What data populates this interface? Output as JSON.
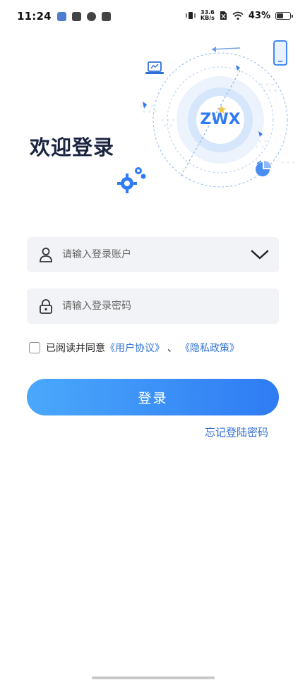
{
  "status_bar": {
    "time": "11:24",
    "net_speed_value": "33.6",
    "net_speed_unit": "KB/s",
    "battery_text": "43%",
    "battery_level": 0.43
  },
  "page": {
    "title": "欢迎登录",
    "brand_logo_text": "ZWX"
  },
  "form": {
    "username_placeholder": "请输入登录账户",
    "password_placeholder": "请输入登录密码",
    "agree_prefix": "已阅读并同意",
    "user_agreement": "《用户协议》",
    "separator": "、",
    "privacy_policy": "《隐私政策》",
    "login_label": "登录",
    "forgot_label": "忘记登陆密码"
  },
  "colors": {
    "accent": "#2f7bf4",
    "link": "#2f6fd6",
    "title": "#1c2540"
  },
  "icons": {
    "user": "user-icon",
    "lock": "lock-icon",
    "dropdown": "chevron-down-icon"
  }
}
